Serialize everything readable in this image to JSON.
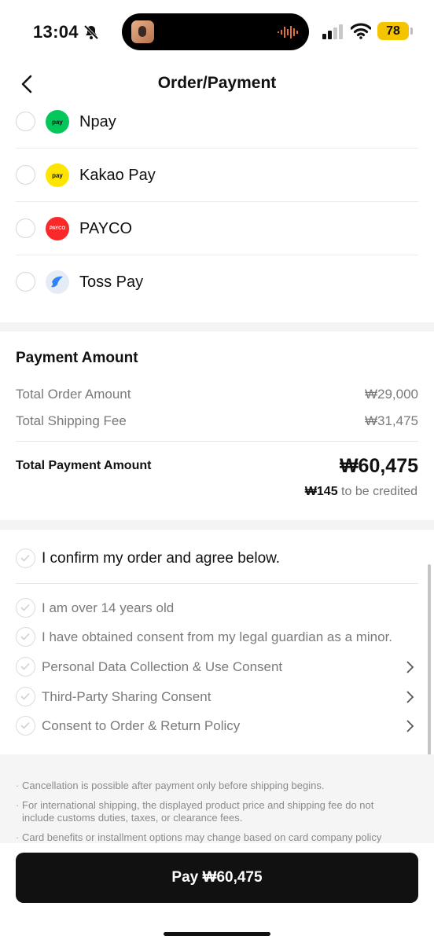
{
  "status_bar": {
    "time": "13:04",
    "battery": "78"
  },
  "header": {
    "title": "Order/Payment"
  },
  "payment_methods": [
    {
      "label": "Npay",
      "logo_text": "pay",
      "color": "#03c75a"
    },
    {
      "label": "Kakao Pay",
      "logo_text": "pay",
      "color": "#fee500"
    },
    {
      "label": "PAYCO",
      "logo_text": "PAYCO",
      "color": "#fa2828"
    },
    {
      "label": "Toss Pay",
      "logo_text": "",
      "color": "#3182f6"
    }
  ],
  "amount": {
    "title": "Payment Amount",
    "order_label": "Total Order Amount",
    "order_value": "₩29,000",
    "shipping_label": "Total Shipping Fee",
    "shipping_value": "₩31,475",
    "total_label": "Total Payment Amount",
    "total_value": "₩60,475",
    "credit_value": "₩145",
    "credit_suffix": "to be credited"
  },
  "agreements": {
    "main": "I confirm my order and agree below.",
    "items": [
      "I am over 14 years old",
      "I have obtained consent from my legal guardian as a minor.",
      "Personal Data Collection & Use Consent",
      "Third-Party Sharing Consent",
      "Consent to Order & Return Policy"
    ]
  },
  "notices": [
    "Cancellation is possible after payment only before shipping begins.",
    "For international shipping, the displayed product price and shipping fee do not include customs duties, taxes, or clearance fees.",
    "Card benefits or installment options may change based on card company policy"
  ],
  "pay_button": "Pay ₩60,475"
}
